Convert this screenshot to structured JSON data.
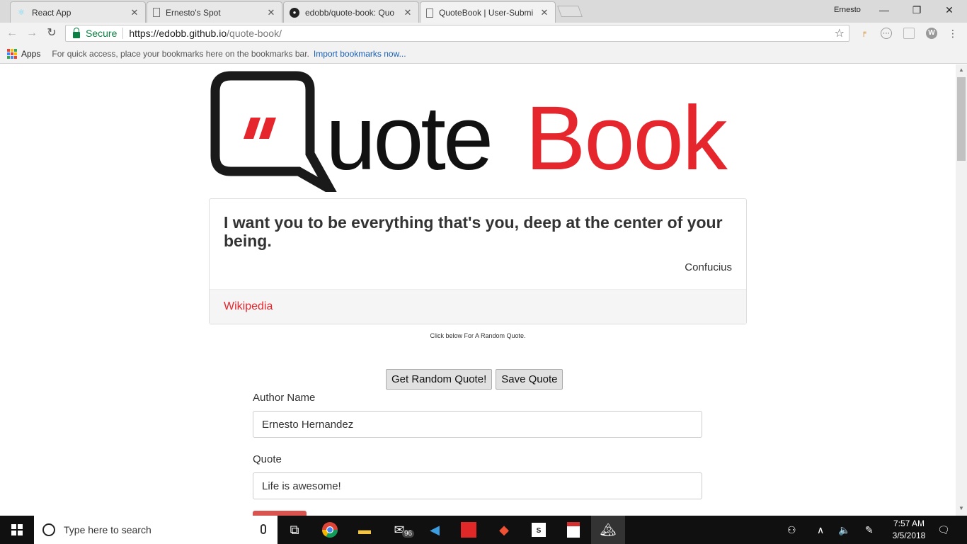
{
  "browser": {
    "tabs": [
      {
        "title": "React App",
        "icon": "react-icon"
      },
      {
        "title": "Ernesto's Spot",
        "icon": "page-icon"
      },
      {
        "title": "edobb/quote-book: Quo",
        "icon": "github-icon"
      },
      {
        "title": "QuoteBook | User-Submi",
        "icon": "page-icon",
        "active": true
      }
    ],
    "user_name": "Ernesto",
    "secure_label": "Secure",
    "url_host": "https://edobb.github.io",
    "url_path": "/quote-book/",
    "bookmarks": {
      "apps_label": "Apps",
      "hint": "For quick access, place your bookmarks here on the bookmarks bar.",
      "import_link": "Import bookmarks now..."
    }
  },
  "logo": {
    "quote_mark": "”",
    "word_quote": "uote",
    "word_book": "Book",
    "colors": {
      "dark": "#1a1a1a",
      "red": "#e5262d"
    }
  },
  "quote_card": {
    "text": "I want you to be everything that's you, deep at the center of your being.",
    "author": "Confucius",
    "link_label": "Wikipedia"
  },
  "hint_text": "Click below For A Random Quote.",
  "buttons": {
    "random": "Get Random Quote!",
    "save": "Save Quote"
  },
  "form": {
    "author_label": "Author Name",
    "author_value": "Ernesto Hernandez",
    "quote_label": "Quote",
    "quote_value": "Life is awesome!"
  },
  "taskbar": {
    "search_placeholder": "Type here to search",
    "mail_badge": "96",
    "time": "7:57 AM",
    "date": "3/5/2018"
  }
}
